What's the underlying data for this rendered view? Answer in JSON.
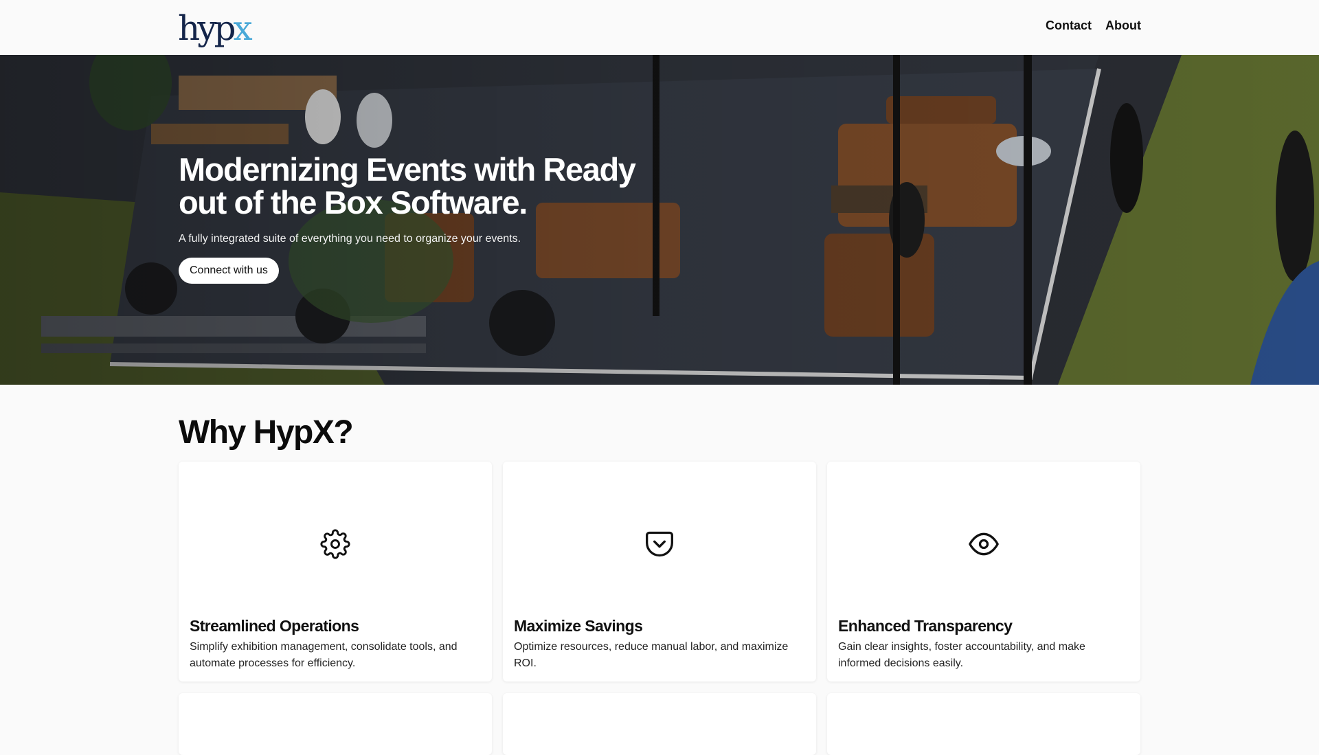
{
  "header": {
    "logo": {
      "part1": "hyp",
      "part2": "x"
    },
    "nav": [
      {
        "label": "Contact"
      },
      {
        "label": "About"
      }
    ]
  },
  "hero": {
    "title": "Modernizing Events with Ready out of the Box Software.",
    "subtitle": "A fully integrated suite of everything you need to organize your events.",
    "cta_label": "Connect with us"
  },
  "why": {
    "title": "Why HypX?",
    "cards": [
      {
        "icon": "gear-icon",
        "title": "Streamlined Operations",
        "text": "Simplify exhibition management, consolidate tools, and automate processes for efficiency."
      },
      {
        "icon": "pocket-icon",
        "title": "Maximize Savings",
        "text": "Optimize resources, reduce manual labor, and maximize ROI."
      },
      {
        "icon": "eye-icon",
        "title": "Enhanced Transparency",
        "text": "Gain clear insights, foster accountability, and make informed decisions easily."
      }
    ]
  },
  "colors": {
    "logo_dark": "#14254a",
    "logo_accent": "#4aa9d8",
    "background": "#fafafa"
  }
}
